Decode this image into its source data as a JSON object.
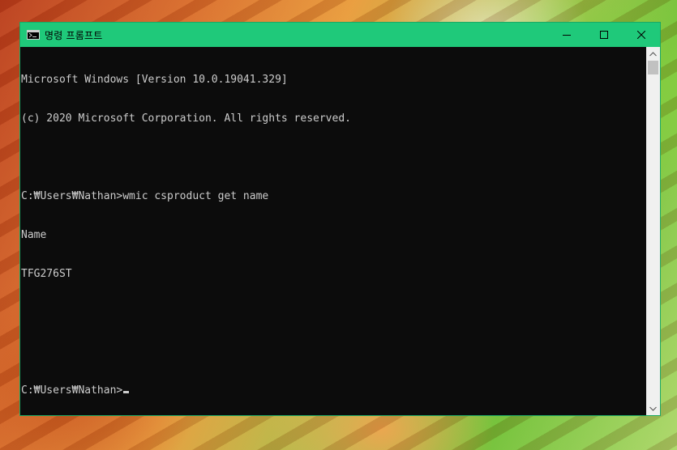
{
  "window": {
    "title": "명령 프롬프트",
    "icon": "cmd-icon",
    "accent_color": "#1fc97a",
    "controls": {
      "minimize_icon": "minimize-icon",
      "maximize_icon": "maximize-icon",
      "close_icon": "close-icon"
    }
  },
  "console": {
    "lines": [
      "Microsoft Windows [Version 10.0.19041.329]",
      "(c) 2020 Microsoft Corporation. All rights reserved.",
      "",
      "C:₩Users₩Nathan>wmic csproduct get name",
      "Name",
      "TFG276ST",
      "",
      "",
      "C:₩Users₩Nathan>"
    ],
    "background_color": "#0c0c0c",
    "text_color": "#cccccc"
  },
  "scrollbar": {
    "up_icon": "scroll-up-arrow-icon",
    "down_icon": "scroll-down-arrow-icon"
  }
}
